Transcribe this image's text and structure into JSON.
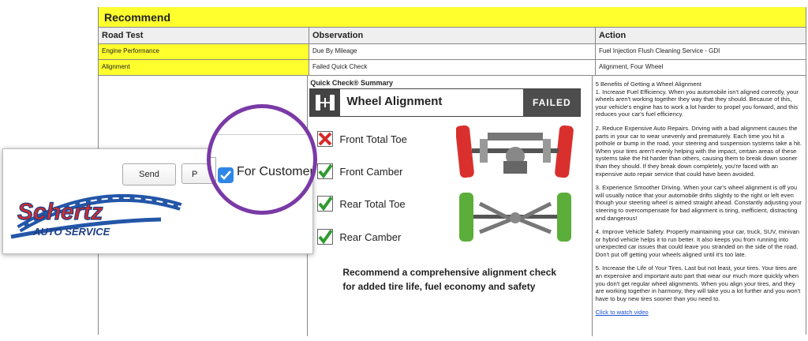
{
  "recommend": {
    "title": "Recommend"
  },
  "headers": {
    "road_test": "Road Test",
    "observation": "Observation",
    "action": "Action"
  },
  "rows": [
    {
      "road_test": "Engine Performance",
      "observation": "Due By Mileage",
      "action": "Fuel Injection Flush Cleaning Service - GDI"
    },
    {
      "road_test": "Alignment",
      "observation": "Failed Quick Check",
      "action": "Alignment, Four Wheel"
    }
  ],
  "quick_check": {
    "title": "Quick Check® Summary",
    "banner_name": "Wheel Alignment",
    "status": "FAILED",
    "items": [
      {
        "label": "Front Total Toe",
        "state": "fail"
      },
      {
        "label": "Front Camber",
        "state": "pass"
      },
      {
        "label": "Rear Total Toe",
        "state": "pass"
      },
      {
        "label": "Rear Camber",
        "state": "pass"
      }
    ],
    "recommend_line1": "Recommend a comprehensive alignment check",
    "recommend_line2": "for added tire life, fuel economy and safety"
  },
  "action_text": {
    "intro": "5 Benefits of Getting a Wheel Alignment",
    "p1": "1. Increase Fuel Efficiency. When you automobile isn't aligned correctly, your wheels aren't working together they way that they should. Because of this, your vehicle's engine has to work a lot harder to propel you forward, and this reduces your car's fuel efficiency.",
    "p2": "2. Reduce Expensive Auto Repairs. Driving with a bad alignment causes the parts in your car to wear unevenly and prematurely. Each time you hit a pothole or bump in the road, your steering and suspension systems take a hit. When your tires aren't evenly helping with the impact, certain areas of these systems take the hit harder than others, causing them to break down sooner than they should. If they break down completely, you're faced with an expensive auto repair service that could have been avoided.",
    "p3": "3. Experience Smoother Driving. When your car's wheel alignment is off you will usually notice that your automobile drifts slightly to the right or left even though your steering wheel is aimed straight ahead. Constantly adjusting your steering to overcompensate for bad alignment is tiring, inefficient, distracting and dangerous!",
    "p4": "4. Improve Vehicle Safety. Properly maintaining your car, truck, SUV, minivan or hybrid vehicle helps it to run better. It also keeps you from running into unexpected car issues that could leave you stranded on the side of the road. Don't put off getting your wheels aligned until it's too late.",
    "p5": "5. Increase the Life of Your Tires. Last but not least, your tires. Your tires are an expensive and important auto part that wear our much more quickly when you don't get regular wheel alignments. When you align your tires, and they are working together in harmony, they will take you a lot further and you won't have to buy new tires sooner than you need to.",
    "video_link": "Click to watch video"
  },
  "overlay": {
    "send_label": "Send",
    "partial_button_label": "P",
    "checkbox_label": "For Customer",
    "checkbox_checked": true,
    "logo_word1": "Schertz",
    "logo_word2": "AUTO SERVICE"
  },
  "colors": {
    "highlight": "#ffff2e",
    "fail": "#d62b2b",
    "pass": "#2f9b2f",
    "magnifier": "#7a3aa6",
    "checkbox": "#2f86e6"
  }
}
